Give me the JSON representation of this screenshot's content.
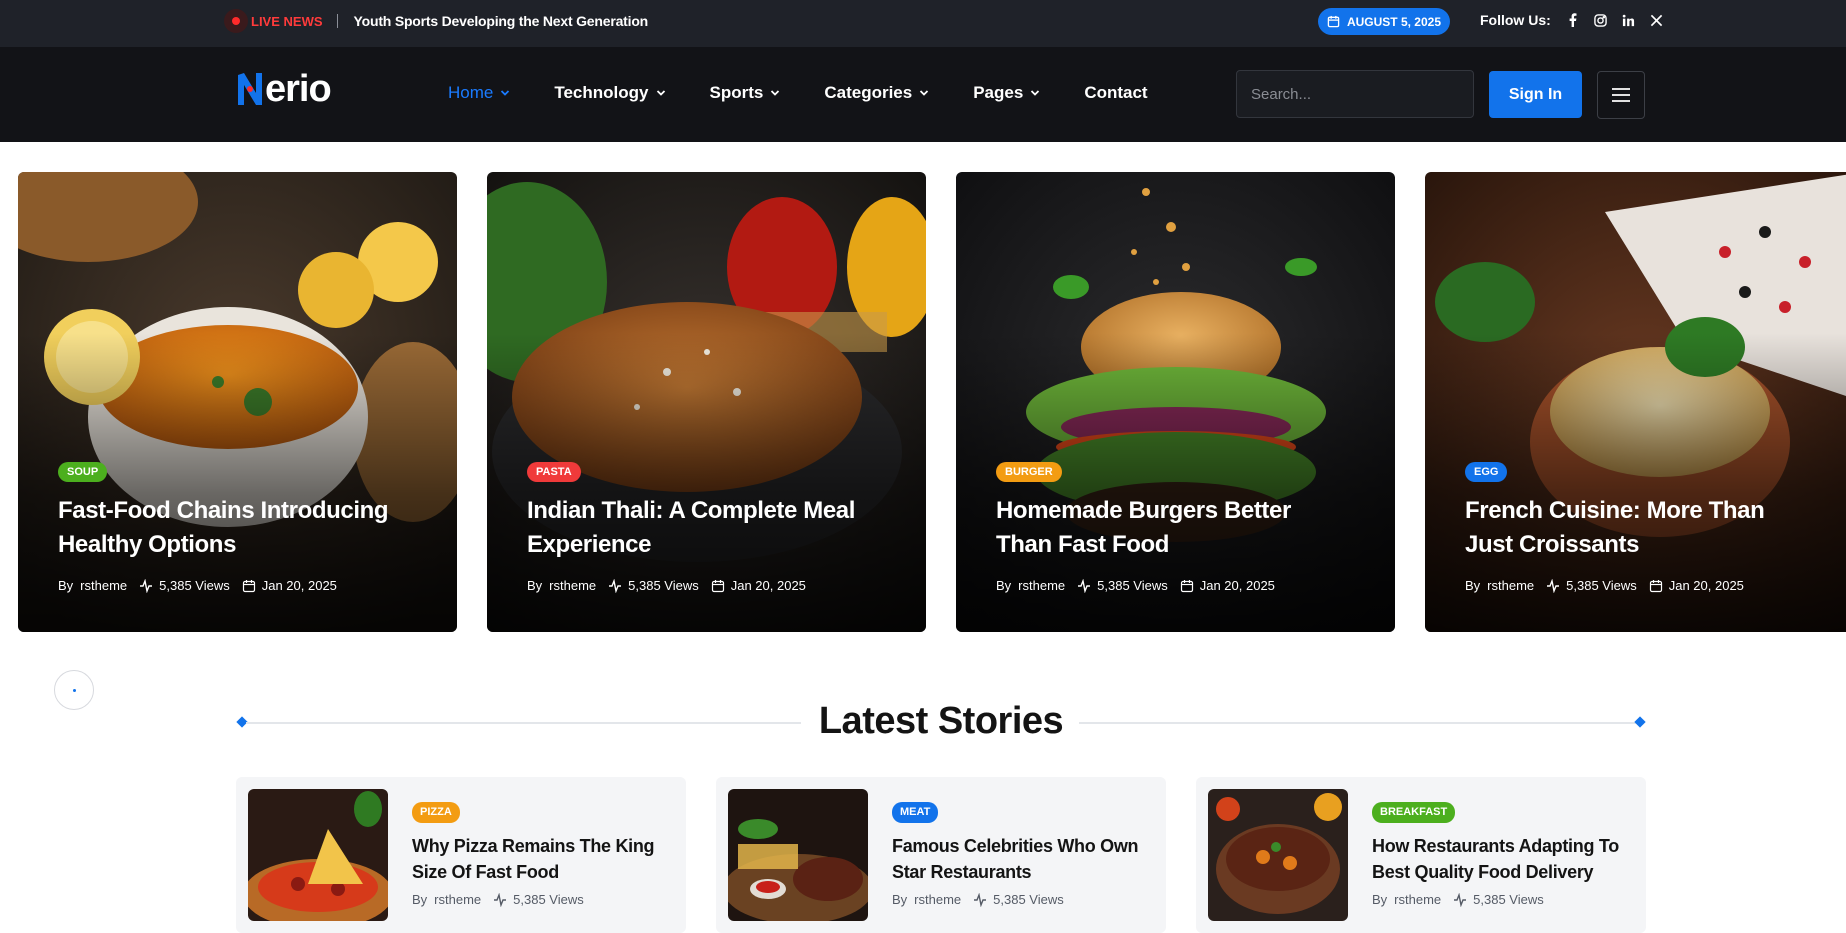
{
  "topbar": {
    "live_label": "LIVE NEWS",
    "headline": "Youth Sports Developing the Next Generation",
    "date": "AUGUST 5, 2025",
    "follow_label": "Follow Us:",
    "socials": [
      "facebook-icon",
      "instagram-icon",
      "linkedin-icon",
      "x-icon"
    ]
  },
  "header": {
    "logo_text": "erio",
    "logo_mark": "N",
    "nav": [
      {
        "label": "Home",
        "active": true,
        "dropdown": true
      },
      {
        "label": "Technology",
        "active": false,
        "dropdown": true
      },
      {
        "label": "Sports",
        "active": false,
        "dropdown": true
      },
      {
        "label": "Categories",
        "active": false,
        "dropdown": true
      },
      {
        "label": "Pages",
        "active": false,
        "dropdown": true
      },
      {
        "label": "Contact",
        "active": false,
        "dropdown": false
      }
    ],
    "search_placeholder": "Search...",
    "signin_label": "Sign In"
  },
  "hero_cards": [
    {
      "tag": "SOUP",
      "tag_color": "#4caf1e",
      "title": "Fast-Food Chains Introducing Healthy Options",
      "by": "By",
      "author": "rstheme",
      "views": "5,385 Views",
      "date": "Jan 20, 2025"
    },
    {
      "tag": "PASTA",
      "tag_color": "#f03a3a",
      "title": "Indian Thali: A Complete Meal Experience",
      "by": "By",
      "author": "rstheme",
      "views": "5,385 Views",
      "date": "Jan 20, 2025"
    },
    {
      "tag": "BURGER",
      "tag_color": "#f39c12",
      "title": "Homemade Burgers Better Than Fast Food",
      "by": "By",
      "author": "rstheme",
      "views": "5,385 Views",
      "date": "Jan 20, 2025"
    },
    {
      "tag": "EGG",
      "tag_color": "#1273eb",
      "title": "French Cuisine: More Than Just Croissants",
      "by": "By",
      "author": "rstheme",
      "views": "5,385 Views",
      "date": "Jan 20, 2025"
    }
  ],
  "latest": {
    "title": "Latest Stories",
    "stories": [
      {
        "tag": "PIZZA",
        "tag_color": "#f39c12",
        "title": "Why Pizza Remains The King Size Of Fast Food",
        "by": "By",
        "author": "rstheme",
        "views": "5,385 Views"
      },
      {
        "tag": "MEAT",
        "tag_color": "#1273eb",
        "title": "Famous Celebrities Who Own Star Restaurants",
        "by": "By",
        "author": "rstheme",
        "views": "5,385 Views"
      },
      {
        "tag": "BREAKFAST",
        "tag_color": "#4caf1e",
        "title": "How Restaurants Adapting To Best Quality Food Delivery",
        "by": "By",
        "author": "rstheme",
        "views": "5,385 Views"
      }
    ]
  },
  "colors": {
    "accent": "#1273eb",
    "live": "#ff3b3b",
    "topbar_bg": "#1f2229",
    "header_bg": "#121317"
  }
}
